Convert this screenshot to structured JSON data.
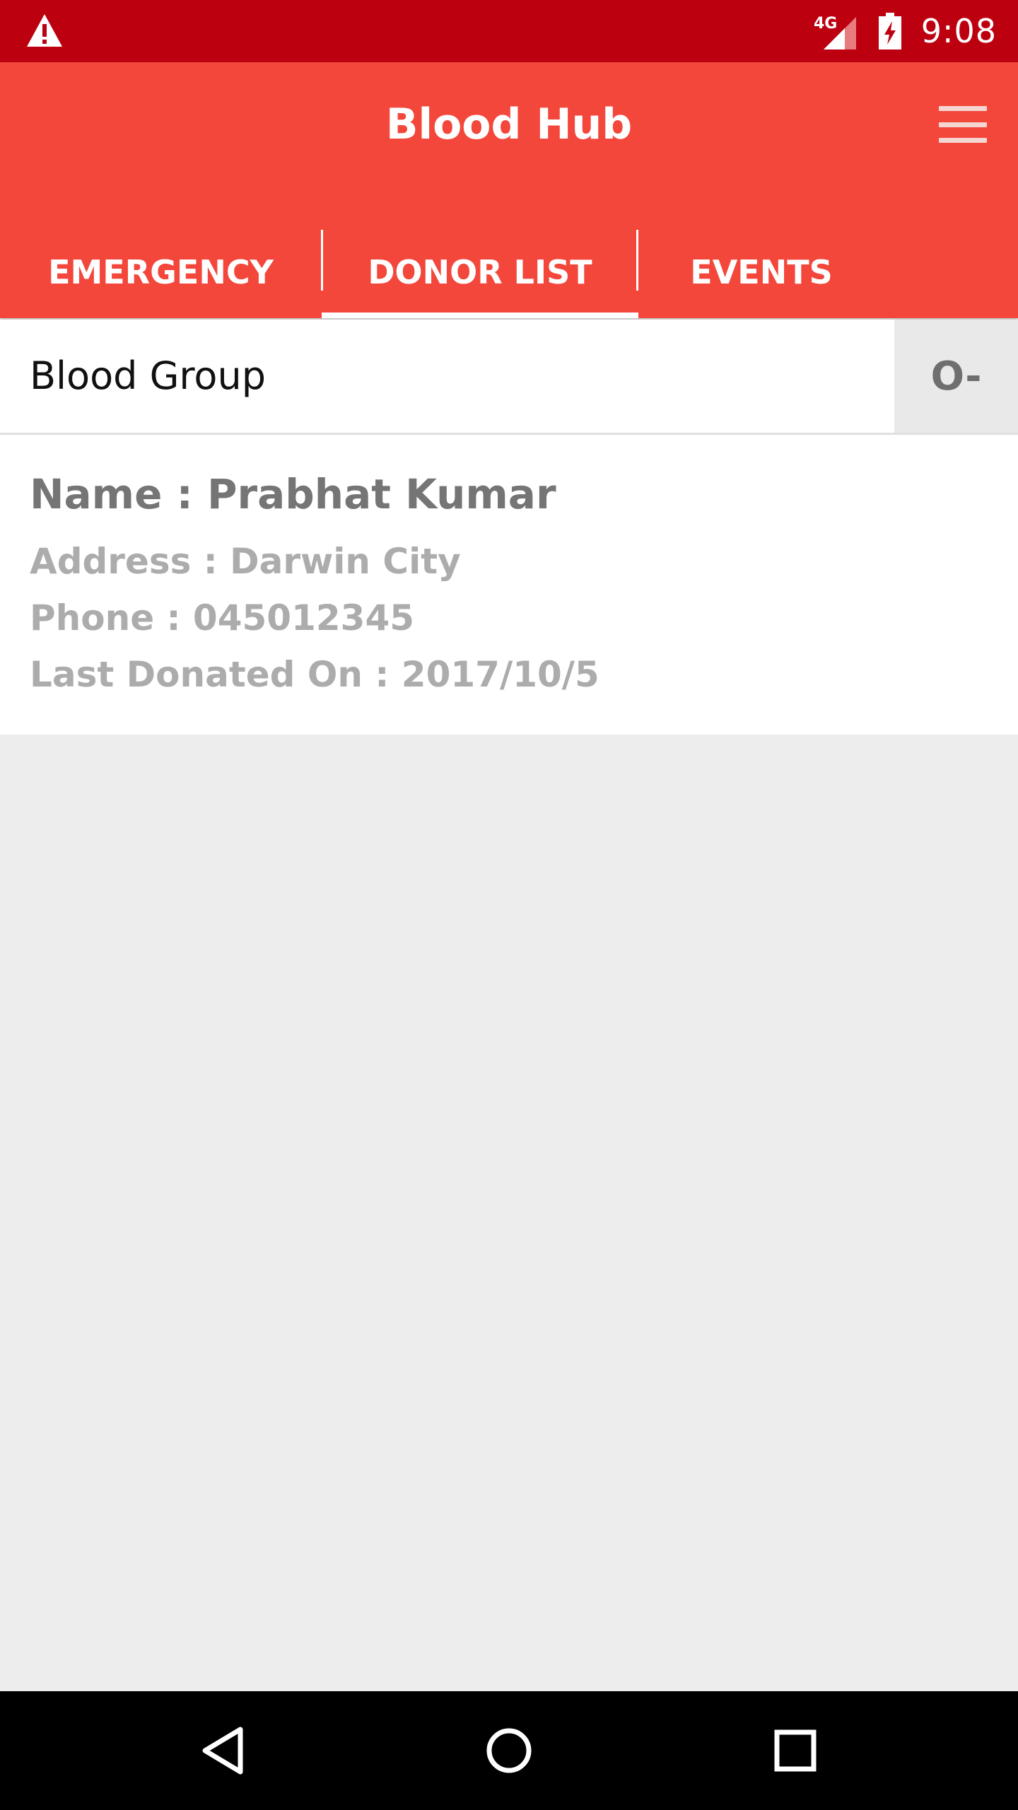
{
  "status_bar": {
    "time": "9:08",
    "network_label": "4G",
    "icons": [
      "warning-icon",
      "signal-icon",
      "battery-charging-icon"
    ]
  },
  "app_bar": {
    "title": "Blood Hub",
    "menu_icon": "hamburger-menu-icon"
  },
  "tabs": [
    {
      "label": "EMERGENCY",
      "selected": false
    },
    {
      "label": "DONOR LIST",
      "selected": true
    },
    {
      "label": "EVENTS",
      "selected": false
    }
  ],
  "filter": {
    "label": "Blood Group",
    "value": "O-"
  },
  "donors": [
    {
      "name": "Name : Prabhat Kumar",
      "address": "Address : Darwin City",
      "phone": "Phone : 045012345",
      "last_donated": "Last Donated On : 2017/10/5"
    }
  ],
  "nav_bar": {
    "icons": [
      "back-icon",
      "home-icon",
      "recents-icon"
    ]
  },
  "colors": {
    "status_bar": "#bd0010",
    "app_bar": "#f3473c",
    "background": "#ededed"
  }
}
